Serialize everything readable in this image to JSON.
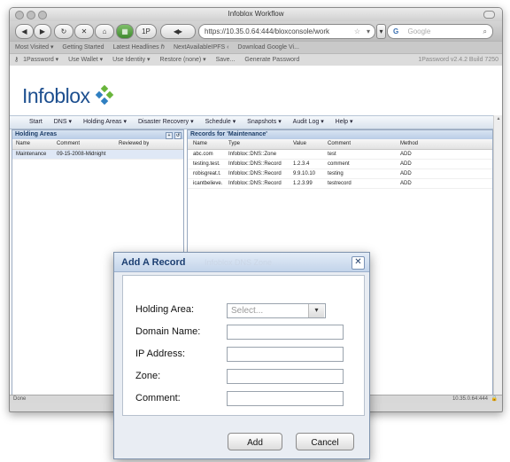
{
  "window": {
    "title": "Infoblox Workflow"
  },
  "nav": {
    "tracking_label": "1P",
    "url": "https://10.35.0.64:444/bloxconsole/work",
    "search_engine_label": "G",
    "search_placeholder": "Google"
  },
  "bookmarks": [
    "Most Visited ▾",
    "Getting Started",
    "Latest Headlines ℏ",
    "NextAvailableIPFS ‹",
    "Download Google Vi..."
  ],
  "password_bar": {
    "items": [
      "1Password ▾",
      "Use Wallet ▾",
      "Use Identity ▾",
      "Restore (none) ▾",
      "Save...",
      "Generate Password"
    ],
    "version": "1Password v2.4.2 Build 7250"
  },
  "app": {
    "logo_text": "Infoblox",
    "menu": [
      "Start",
      "DNS ▾",
      "Holding Areas ▾",
      "Disaster Recovery ▾",
      "Schedule ▾",
      "Snapshots ▾",
      "Audit Log ▾",
      "Help ▾"
    ]
  },
  "holding_panel": {
    "title": "Holding Areas",
    "tool_buttons": [
      "+",
      "↺"
    ],
    "columns": [
      "Name",
      "Comment",
      "Reviewed by"
    ],
    "rows": [
      [
        "Maintenance",
        "09-15-2008-Midnight",
        ""
      ]
    ]
  },
  "records_panel": {
    "title": "Records for 'Maintenance'",
    "columns": [
      "Name",
      "Type",
      "Value",
      "Comment",
      "Method"
    ],
    "rows": [
      [
        "abc.com",
        "Infoblox::DNS::Zone",
        "",
        "test",
        "ADD"
      ],
      [
        "testing.test.",
        "Infoblox::DNS::Record",
        "1.2.3.4",
        "comment",
        "ADD"
      ],
      [
        "robisgreat.t.",
        "Infoblox::DNS::Record",
        "9.9.10.10",
        "testing",
        "ADD"
      ],
      [
        "icantbelieve.",
        "Infoblox::DNS::Record",
        "1.2.3.99",
        "testrecord",
        "ADD"
      ]
    ]
  },
  "status": {
    "left": "Done",
    "right": "10.35.0.64:444"
  },
  "dialog": {
    "title": "Add A Record",
    "ghost_text": "Infoblox DNS Zone",
    "close_glyph": "✕",
    "fields": {
      "holding_area": {
        "label": "Holding Area:",
        "placeholder": "Select..."
      },
      "domain_name": {
        "label": "Domain Name:",
        "value": ""
      },
      "ip_address": {
        "label": "IP Address:",
        "value": ""
      },
      "zone": {
        "label": "Zone:",
        "value": ""
      },
      "comment": {
        "label": "Comment:",
        "value": ""
      }
    },
    "add_label": "Add",
    "cancel_label": "Cancel"
  }
}
